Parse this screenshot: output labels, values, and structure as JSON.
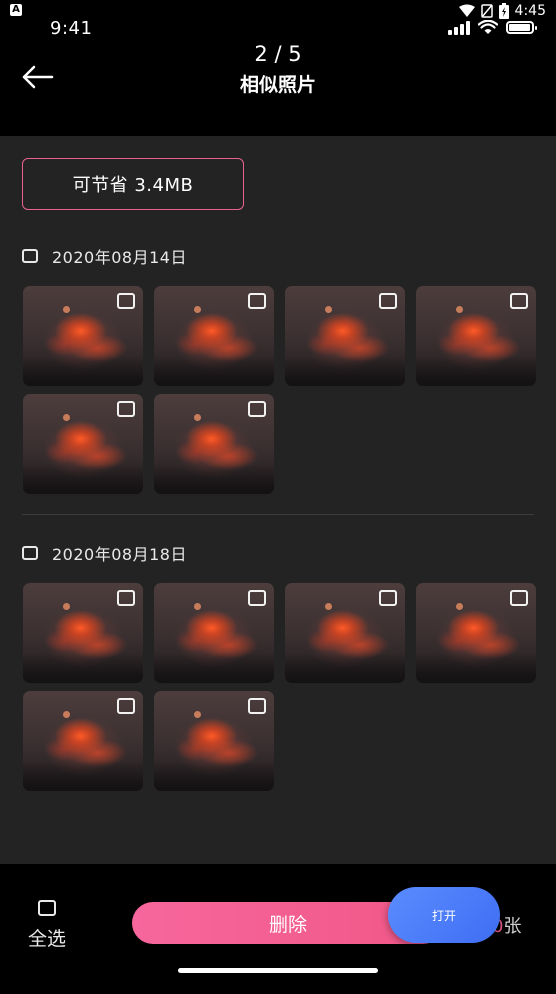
{
  "status_bar": {
    "android_time": "4:45",
    "notification_badge": "A",
    "ios_time": "9:41",
    "icons": [
      "wifi-icon",
      "no-sim-icon",
      "battery-charging-icon",
      "signal-icon",
      "battery-icon"
    ]
  },
  "header": {
    "counter": "2 / 5",
    "title": "相似照片"
  },
  "savings": {
    "label": "可节省 3.4MB"
  },
  "groups": [
    {
      "date": "2020年08月14日",
      "photo_count": 6
    },
    {
      "date": "2020年08月18日",
      "photo_count": 6
    }
  ],
  "footer": {
    "select_all_label": "全选",
    "delete_label": "删除",
    "open_label": "打开",
    "count_number": "0",
    "count_unit": "张"
  },
  "colors": {
    "accent_pink": "#f05787",
    "open_blue": "#3f6ef3",
    "content_bg": "#232323"
  }
}
